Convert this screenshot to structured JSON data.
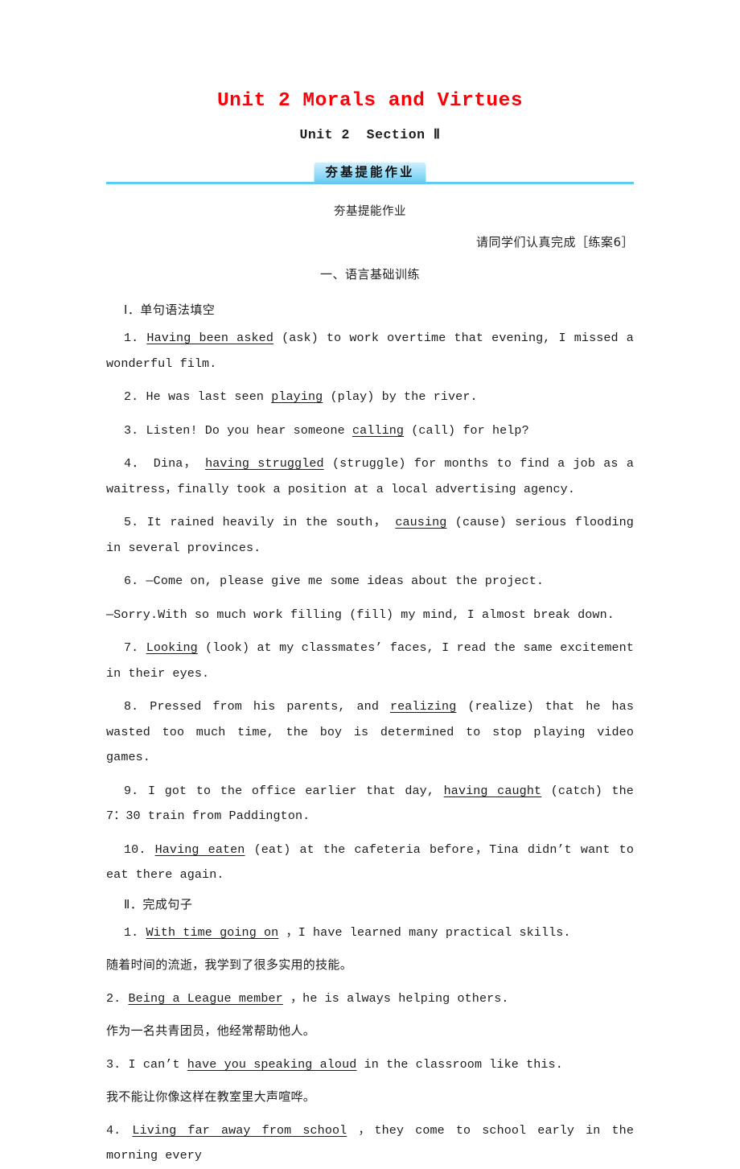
{
  "header": {
    "main_title": "Unit 2 Morals and Virtues",
    "sub_title": "Unit 2  Section Ⅱ",
    "badge_label": "夯基提能作业",
    "badge_caption": "夯基提能作业",
    "instruction": "请同学们认真完成［练案6］",
    "section_heading": "一、语言基础训练",
    "accent_red": "#fb0007",
    "accent_blue": "#3ec4f2"
  },
  "part1": {
    "label": "Ⅰ．单句语法填空",
    "items": [
      {
        "num": "1.",
        "pre": "",
        "blank": "Having been asked",
        "post": "(ask) to work overtime that evening, I missed a wonderful film.",
        "line1": "1. Having been asked (ask) to work overtime that evening, I missed a wonderful",
        "line2": "film."
      },
      {
        "num": "2.",
        "pre": "He was last seen",
        "blank": "playing",
        "post": "(play) by the river.",
        "line1": "2. He was last seen  playing  (play) by the river."
      },
      {
        "num": "3.",
        "pre": "Listen! Do you hear someone",
        "blank": "calling",
        "post": "(call) for help?",
        "line1": "3. Listen! Do you hear someone  calling  (call) for help?"
      },
      {
        "num": "4．",
        "pre": "Dina，",
        "blank": "having struggled",
        "post": "(struggle) for months to find a job as a waitress，finally took a position at a local advertising agency.",
        "line1": "4．Dina， having struggled (struggle) for months to find a job as a",
        "line2": "waitress，finally took a position at a local advertising agency."
      },
      {
        "num": "5.",
        "pre": "It rained heavily in the  south，",
        "blank": "causing",
        "post": "(cause) serious flooding in several provinces.",
        "line1": "5. It rained heavily in the  south， causing (cause) serious flooding in several",
        "line2": "provinces."
      },
      {
        "num": "6.",
        "pre": "—Come on, please give me some ideas about the project.",
        "blank": "filling",
        "post": "(fill) my mind, I almost break down.",
        "line1": "6. —Come on, please give me some ideas about the project.",
        "line2": "—Sorry.With so much work  filling  (fill) my mind, I almost break down."
      },
      {
        "num": "7.",
        "pre": "",
        "blank": "Looking",
        "post": "(look) at my classmates’ faces, I read the same excitement in their eyes.",
        "line1": "7.  Looking  (look) at my classmates’ faces, I read the same excitement in their",
        "line2": "eyes."
      },
      {
        "num": "8.",
        "pre": "Pressed from his parents, and",
        "blank": "realizing",
        "post": "(realize) that he has wasted too much time, the boy is determined to stop playing video games.",
        "line1": "8. Pressed from his parents, and  realizing  (realize) that he has wasted too",
        "line2": "much time, the boy is determined to stop playing video games."
      },
      {
        "num": "9.",
        "pre": "I got to the office earlier that day,",
        "blank": "having caught",
        "post": "(catch) the 7：30 train from Paddington.",
        "line1": "9. I got to the office earlier that day,  having caught  (catch) the 7：30 train",
        "line2": "from Paddington."
      },
      {
        "num": "10.",
        "pre": "",
        "blank": "Having eaten",
        "post": "(eat) at the cafeteria before，Tina didn’t want to eat there again.",
        "line1": "10.  Having eaten  (eat) at the cafeteria before，Tina didn’t want to eat there",
        "line2": "again."
      }
    ]
  },
  "part2": {
    "label": "Ⅱ．完成句子",
    "items": [
      {
        "num": "1.",
        "blank": "With time going on",
        "post": "，I have learned many practical skills.",
        "cn": "随着时间的流逝，我学到了很多实用的技能。"
      },
      {
        "num": "2.",
        "blank": "Being a League member",
        "post": "，he is always helping others.",
        "cn": "作为一名共青团员，他经常帮助他人。"
      },
      {
        "num": "3.",
        "pre": "I can’t",
        "blank": "have you speaking aloud",
        "post": "in the classroom like this.",
        "cn": "我不能让你像这样在教室里大声喧哗。"
      },
      {
        "num": "4.",
        "blank": "Living far away from school",
        "post": "，they come to school early in the morning every"
      }
    ]
  }
}
